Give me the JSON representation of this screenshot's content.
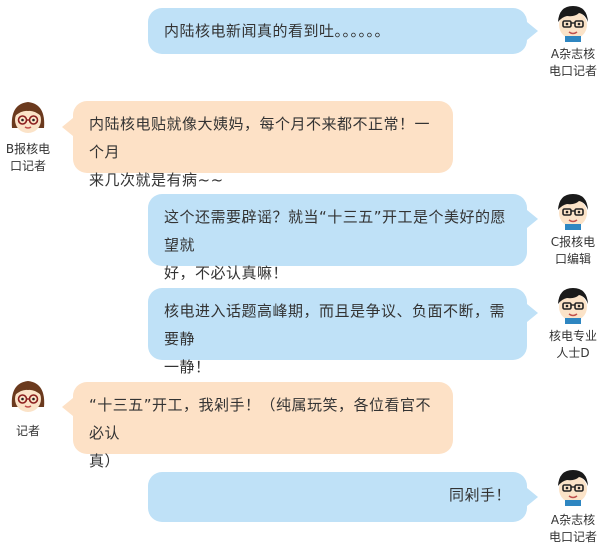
{
  "messages": [
    {
      "side": "right",
      "text": "内陆核电新闻真的看到吐。。。。。。",
      "name_line1": "A杂志核",
      "name_line2": "电口记者",
      "avatar": "boy-avatar-icon"
    },
    {
      "side": "left",
      "text_line1": "内陆核电贴就像大姨妈，每个月不来都不正常！一个月",
      "text_line2": "来几次就是有病~~",
      "name_line1": "B报核电",
      "name_line2": "口记者",
      "avatar": "girl-avatar-icon"
    },
    {
      "side": "right",
      "text_line1": "这个还需要辟谣？就当“十三五”开工是个美好的愿望就",
      "text_line2": "好，不必认真嘛！",
      "name_line1": "C报核电",
      "name_line2": "口编辑",
      "avatar": "boy-avatar-icon"
    },
    {
      "side": "right",
      "text_line1": "核电进入话题高峰期，而且是争议、负面不断，需要静",
      "text_line2": "一静！",
      "name_line1": "核电专业",
      "name_line2": "人士D",
      "avatar": "boy-avatar-icon"
    },
    {
      "side": "left",
      "text_line1": "“十三五”开工，我剁手！（纯属玩笑，各位看官不必认",
      "text_line2": "真）",
      "name_line1": "记者",
      "avatar": "girl-avatar-icon"
    },
    {
      "side": "right",
      "text": "同剁手！",
      "name_line1": "A杂志核",
      "name_line2": "电口记者",
      "avatar": "boy-avatar-icon"
    }
  ],
  "colors": {
    "right_bubble": "#bfe1f7",
    "left_bubble": "#fde1c6"
  }
}
